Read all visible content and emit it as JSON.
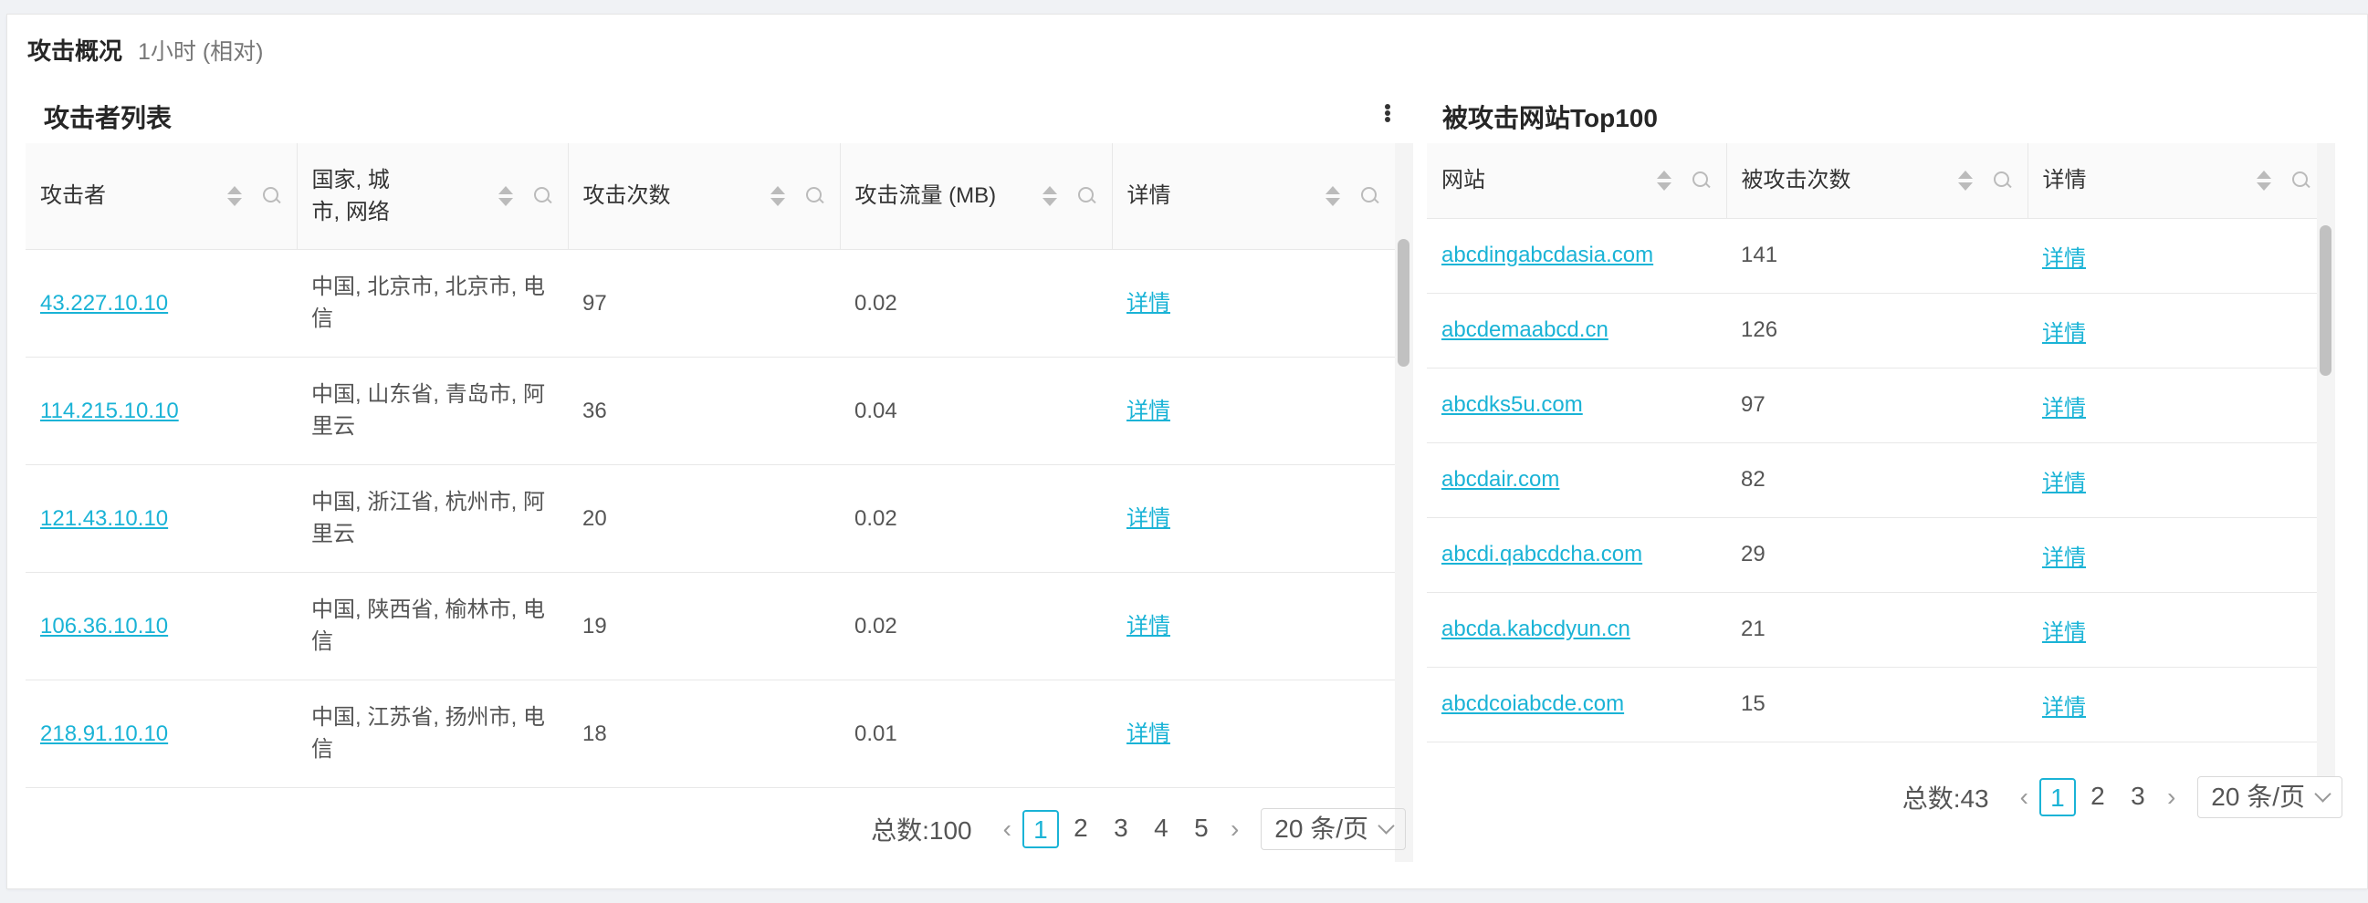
{
  "header": {
    "title": "攻击概况",
    "subtitle": "1小时 (相对)"
  },
  "attackers": {
    "title": "攻击者列表",
    "columns": [
      "攻击者",
      "国家, 城市, 网络",
      "攻击次数",
      "攻击流量 (MB)",
      "详情"
    ],
    "rows": [
      {
        "ip": "43.227.10.10",
        "location": "中国, 北京市, 北京市, 电信",
        "count": "97",
        "traffic": "0.02",
        "detail": "详情"
      },
      {
        "ip": "114.215.10.10",
        "location": "中国, 山东省, 青岛市, 阿里云",
        "count": "36",
        "traffic": "0.04",
        "detail": "详情"
      },
      {
        "ip": "121.43.10.10",
        "location": "中国, 浙江省, 杭州市, 阿里云",
        "count": "20",
        "traffic": "0.02",
        "detail": "详情"
      },
      {
        "ip": "106.36.10.10",
        "location": "中国, 陕西省, 榆林市, 电信",
        "count": "19",
        "traffic": "0.02",
        "detail": "详情"
      },
      {
        "ip": "218.91.10.10",
        "location": "中国, 江苏省, 扬州市, 电信",
        "count": "18",
        "traffic": "0.01",
        "detail": "详情"
      }
    ],
    "pager": {
      "total": "总数:100",
      "pages": [
        "1",
        "2",
        "3",
        "4",
        "5"
      ],
      "current": "1",
      "page_size": "20 条/页"
    }
  },
  "sites": {
    "title": "被攻击网站Top100",
    "columns": [
      "网站",
      "被攻击次数",
      "详情"
    ],
    "rows": [
      {
        "site": "abcdingabcdasia.com",
        "count": "141",
        "detail": "详情"
      },
      {
        "site": "abcdemaabcd.cn",
        "count": "126",
        "detail": "详情"
      },
      {
        "site": "abcdks5u.com",
        "count": "97",
        "detail": "详情"
      },
      {
        "site": "abcdair.com",
        "count": "82",
        "detail": "详情"
      },
      {
        "site": "abcdi.qabcdcha.com",
        "count": "29",
        "detail": "详情"
      },
      {
        "site": "abcda.kabcdyun.cn",
        "count": "21",
        "detail": "详情"
      },
      {
        "site": "abcdcoiabcde.com",
        "count": "15",
        "detail": "详情"
      }
    ],
    "pager": {
      "total": "总数:43",
      "pages": [
        "1",
        "2",
        "3"
      ],
      "current": "1",
      "page_size": "20 条/页"
    }
  }
}
